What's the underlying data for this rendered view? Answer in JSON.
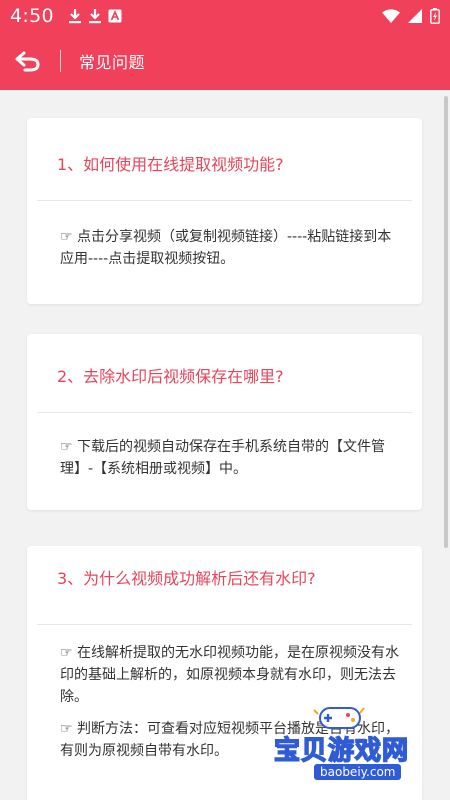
{
  "status_bar": {
    "time": "4:50",
    "left_icons": [
      "download-icon",
      "download-icon",
      "font-icon"
    ],
    "right_icons": [
      "wifi-icon",
      "signal-icon",
      "battery-charging-icon"
    ]
  },
  "app_bar": {
    "title": "常见问题",
    "background": "#f0405a"
  },
  "faq": [
    {
      "question": "1、如何使用在线提取视频功能?",
      "answers": [
        "☞ 点击分享视频（或复制视频链接）----粘贴链接到本应用----点击提取视频按钮。"
      ]
    },
    {
      "question": "2、去除水印后视频保存在哪里?",
      "answers": [
        "☞ 下载后的视频自动保存在手机系统自带的【文件管理】-【系统相册或视频】中。"
      ]
    },
    {
      "question": "3、为什么视频成功解析后还有水印?",
      "answers": [
        "☞ 在线解析提取的无水印视频功能，是在原视频没有水印的基础上解析的，如原视频本身就有水印，则无法去除。",
        "☞ 判断方法：可查看对应短视频平台播放是否有水印，有则为原视频自带有水印。"
      ]
    }
  ],
  "watermark": {
    "text": "宝贝游戏网",
    "url": "baobeiy.com"
  },
  "colors": {
    "accent": "#f0405a",
    "question_text": "#e8455c",
    "background": "#f2f2f2"
  }
}
